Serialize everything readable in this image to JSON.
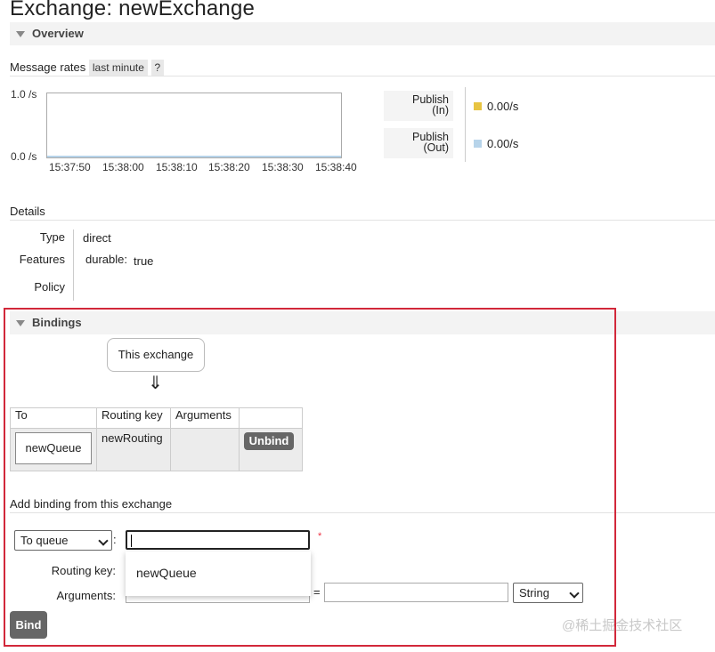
{
  "page": {
    "title": "Exchange: newExchange"
  },
  "overview": {
    "header": "Overview",
    "message_rates_label": "Message rates",
    "range_pill": "last minute",
    "help_pill": "?",
    "chart_data": {
      "type": "line",
      "title": "",
      "xlabel": "",
      "ylabel": "",
      "y_ticks": [
        "1.0 /s",
        "0.0 /s"
      ],
      "x_ticks": [
        "15:37:50",
        "15:38:00",
        "15:38:10",
        "15:38:20",
        "15:38:30",
        "15:38:40"
      ],
      "ylim": [
        0,
        1
      ],
      "series": [
        {
          "name": "Publish (In)",
          "color": "#e8c442",
          "values": [
            0,
            0,
            0,
            0,
            0,
            0
          ]
        },
        {
          "name": "Publish (Out)",
          "color": "#b7d4ea",
          "values": [
            0,
            0,
            0,
            0,
            0,
            0
          ]
        }
      ]
    },
    "legend": [
      {
        "line1": "Publish",
        "line2": "(In)",
        "value": "0.00/s",
        "color": "#e8c442"
      },
      {
        "line1": "Publish",
        "line2": "(Out)",
        "value": "0.00/s",
        "color": "#b7d4ea"
      }
    ]
  },
  "details": {
    "label": "Details",
    "type_key": "Type",
    "type_value": "direct",
    "features_key": "Features",
    "features_sub_key": "durable:",
    "features_sub_value": "true",
    "policy_key": "Policy"
  },
  "bindings": {
    "header": "Bindings",
    "source_bubble": "This exchange",
    "arrow": "⇓",
    "columns": [
      "To",
      "Routing key",
      "Arguments",
      ""
    ],
    "rows": [
      {
        "to": "newQueue",
        "routing_key": "newRouting",
        "arguments": "",
        "action": "Unbind"
      }
    ]
  },
  "add_binding": {
    "label": "Add binding from this exchange",
    "destination_type": "To queue",
    "colon": ":",
    "destination_value": "",
    "required_mark": "*",
    "routing_key_label": "Routing key:",
    "arguments_label": "Arguments:",
    "equals": "=",
    "arg_type": "String",
    "suggestion": "newQueue",
    "bind_button": "Bind"
  },
  "watermark": "@稀土掘金技术社区",
  "colors": {
    "highlight_frame": "#d2283a",
    "button": "#666666"
  }
}
